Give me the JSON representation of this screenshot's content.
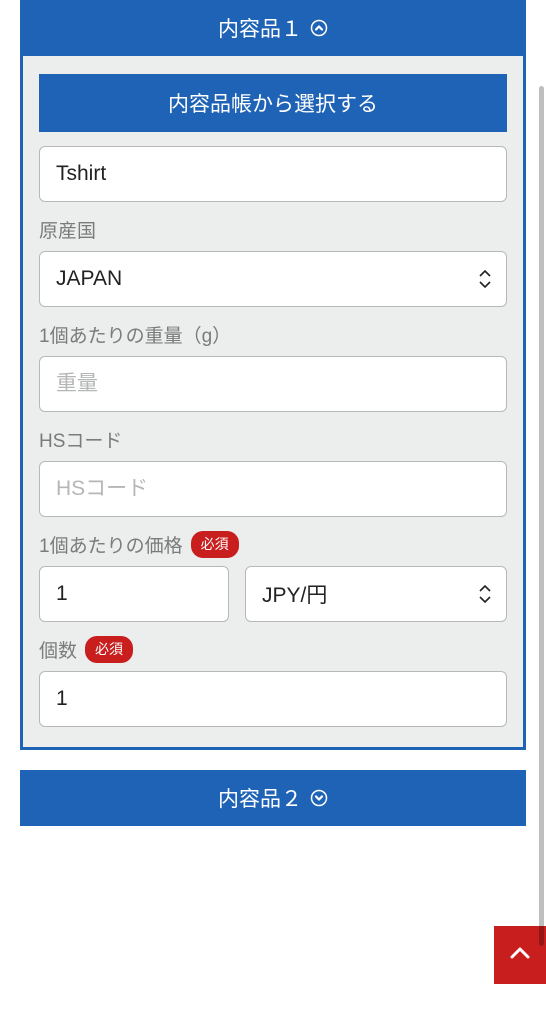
{
  "section1": {
    "header": "内容品１",
    "select_from_book": "内容品帳から選択する",
    "item_name_value": "Tshirt",
    "origin_label": "原産国",
    "origin_value": "JAPAN",
    "weight_label": "1個あたりの重量（g）",
    "weight_placeholder": "重量",
    "hs_label": "HSコード",
    "hs_placeholder": "HSコード",
    "price_label": "1個あたりの価格",
    "required_badge": "必須",
    "price_value": "1",
    "currency_value": "JPY/円",
    "qty_label": "個数",
    "qty_value": "1"
  },
  "section2": {
    "header": "内容品２"
  }
}
